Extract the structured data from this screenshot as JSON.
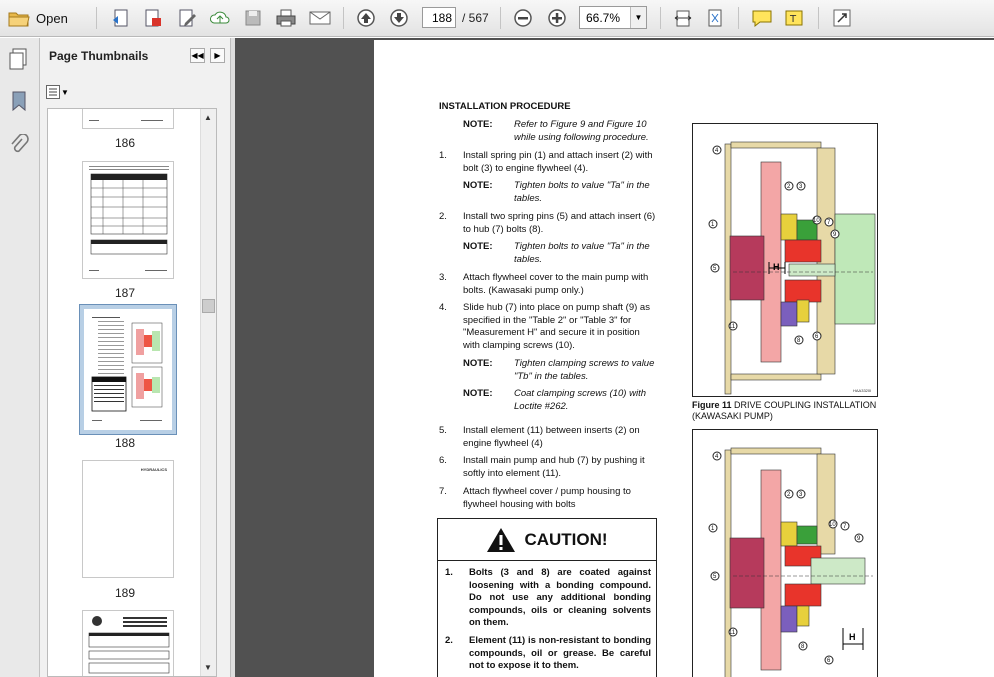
{
  "toolbar": {
    "open_label": "Open",
    "current_page": "188",
    "page_total": "/ 567",
    "zoom": "66.7%"
  },
  "sidebar": {
    "title": "Page Thumbnails",
    "thumbnails": [
      {
        "label": "186"
      },
      {
        "label": "187"
      },
      {
        "label": "188"
      },
      {
        "label": "189"
      }
    ],
    "partial_thumb_text": "HYDRAULICS"
  },
  "document": {
    "heading": "INSTALLATION PROCEDURE",
    "note_label": "NOTE:",
    "note_intro": "Refer to Figure 9 and Figure 10 while using following procedure.",
    "steps": [
      {
        "num": "1.",
        "text": "Install spring pin (1) and attach insert (2) with bolt (3) to engine flywheel (4).",
        "note": "Tighten bolts to value \"Ta\" in the tables."
      },
      {
        "num": "2.",
        "text": "Install two spring pins (5) and attach insert (6) to hub (7) bolts (8).",
        "note": "Tighten bolts to value \"Ta\" in the tables."
      },
      {
        "num": "3.",
        "text": "Attach flywheel cover to the main pump with bolts. (Kawasaki pump only.)"
      },
      {
        "num": "4.",
        "text": "Slide hub (7) into place on pump shaft (9) as specified in the \"Table 2\" or \"Table 3\" for \"Measurement H\" and secure it in position with clamping screws (10).",
        "note": "Tighten clamping screws to value \"Tb\" in the tables.",
        "note2": "Coat clamping screws (10) with Loctite #262."
      },
      {
        "num": "5.",
        "text": "Install element (11) between inserts (2) on engine flywheel (4)"
      },
      {
        "num": "6.",
        "text": "Install main pump and hub (7) by pushing it softly into element (11)."
      },
      {
        "num": "7.",
        "text": "Attach flywheel cover / pump housing to flywheel housing with bolts"
      }
    ],
    "caution_title": "CAUTION!",
    "caution_items": [
      {
        "num": "1.",
        "text": "Bolts (3 and 8) are coated against loosening with a bonding compound. Do not use any additional bonding compounds, oils or cleaning solvents on them."
      },
      {
        "num": "2.",
        "text": "Element (11) is non-resistant to bonding compounds, oil or grease. Be careful not to expose it to them."
      }
    ],
    "figure11_label": "Figure 11",
    "figure11_caption": " DRIVE COUPLING INSTALLATION (KAWASAKI PUMP)",
    "figure_code": "HAA3320I",
    "fig_h_label": "H",
    "callouts": [
      "4",
      "2",
      "3",
      "1",
      "10",
      "7",
      "9",
      "5",
      "11",
      "8",
      "6"
    ]
  }
}
